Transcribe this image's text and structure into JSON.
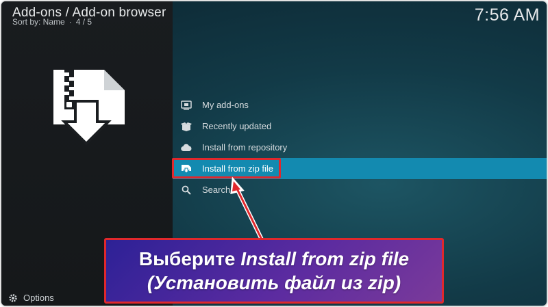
{
  "header": {
    "title": "Add-ons / Add-on browser",
    "sort_label": "Sort by: Name",
    "separator": "·",
    "position": "4 / 5",
    "clock": "7:56 AM"
  },
  "menu": {
    "items": [
      {
        "label": "My add-ons",
        "icon": "monitor-box-icon"
      },
      {
        "label": "Recently updated",
        "icon": "open-box-icon"
      },
      {
        "label": "Install from repository",
        "icon": "cloud-icon"
      },
      {
        "label": "Install from zip file",
        "icon": "zip-download-icon",
        "selected": true
      },
      {
        "label": "Search",
        "icon": "search-icon"
      }
    ]
  },
  "footer": {
    "options_label": "Options"
  },
  "callout": {
    "line1_prefix": "Выберите ",
    "line1_emphasis": "Install from zip file",
    "line2": "(Установить файл из zip)"
  },
  "colors": {
    "accent": "#138ab0",
    "annotation_red": "#e0282c",
    "callout_bg": "#3c2596"
  }
}
